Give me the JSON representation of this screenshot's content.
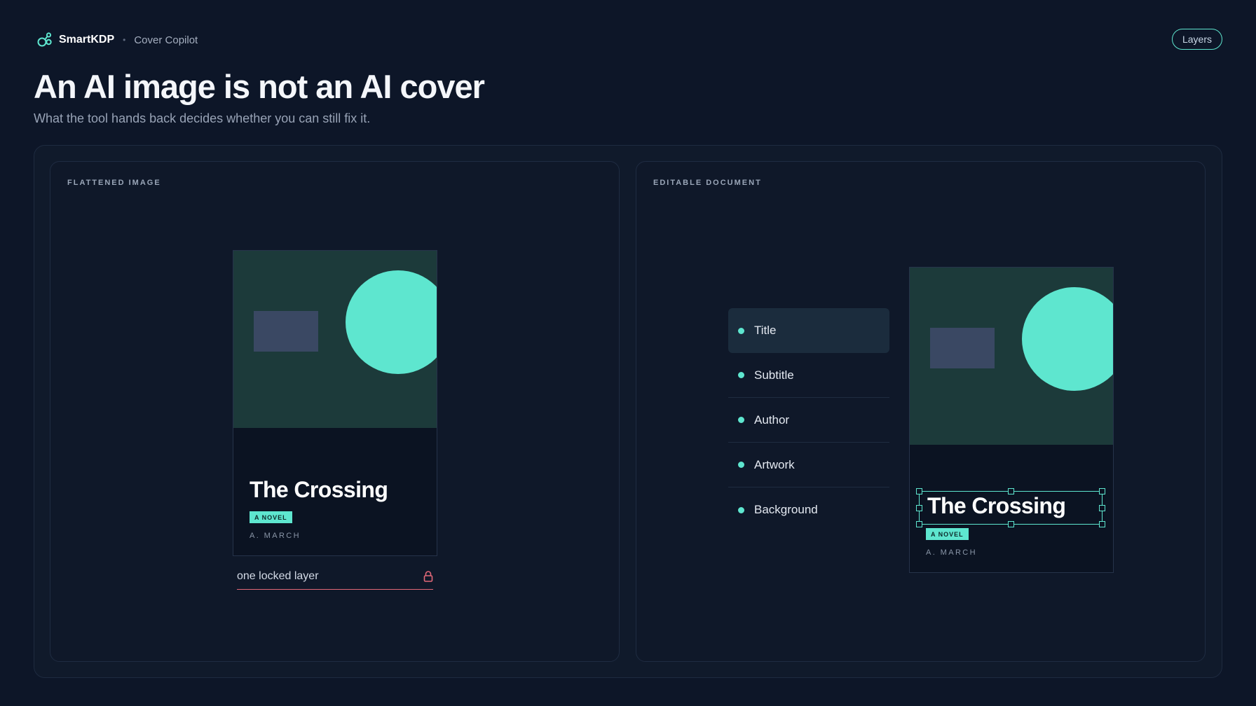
{
  "brand": {
    "name": "SmartKDP",
    "separator": "•",
    "product": "Cover Copilot",
    "logo_icon": "logo-mark-icon"
  },
  "header": {
    "layers_button": "Layers"
  },
  "hero": {
    "title": "An AI image is not an AI cover",
    "subtitle": "What the tool hands back decides whether you can still fix it."
  },
  "left_panel": {
    "label": "FLATTENED IMAGE",
    "cover": {
      "title": "The Crossing",
      "badge": "A NOVEL",
      "author": "A. MARCH"
    },
    "status": {
      "text": "one locked layer",
      "icon": "lock-icon"
    }
  },
  "right_panel": {
    "label": "EDITABLE DOCUMENT",
    "layers": [
      {
        "label": "Title",
        "active": true
      },
      {
        "label": "Subtitle",
        "active": false
      },
      {
        "label": "Author",
        "active": false
      },
      {
        "label": "Artwork",
        "active": false
      },
      {
        "label": "Background",
        "active": false
      }
    ],
    "cover": {
      "title": "The Crossing",
      "badge": "A NOVEL",
      "author": "A. MARCH",
      "selected_layer": "Title"
    }
  },
  "colors": {
    "background": "#0d1628",
    "accent": "#5ee6cf",
    "cover_art": "#1c3a3a",
    "art_rect": "#3a4863",
    "locked": "#e26878"
  }
}
